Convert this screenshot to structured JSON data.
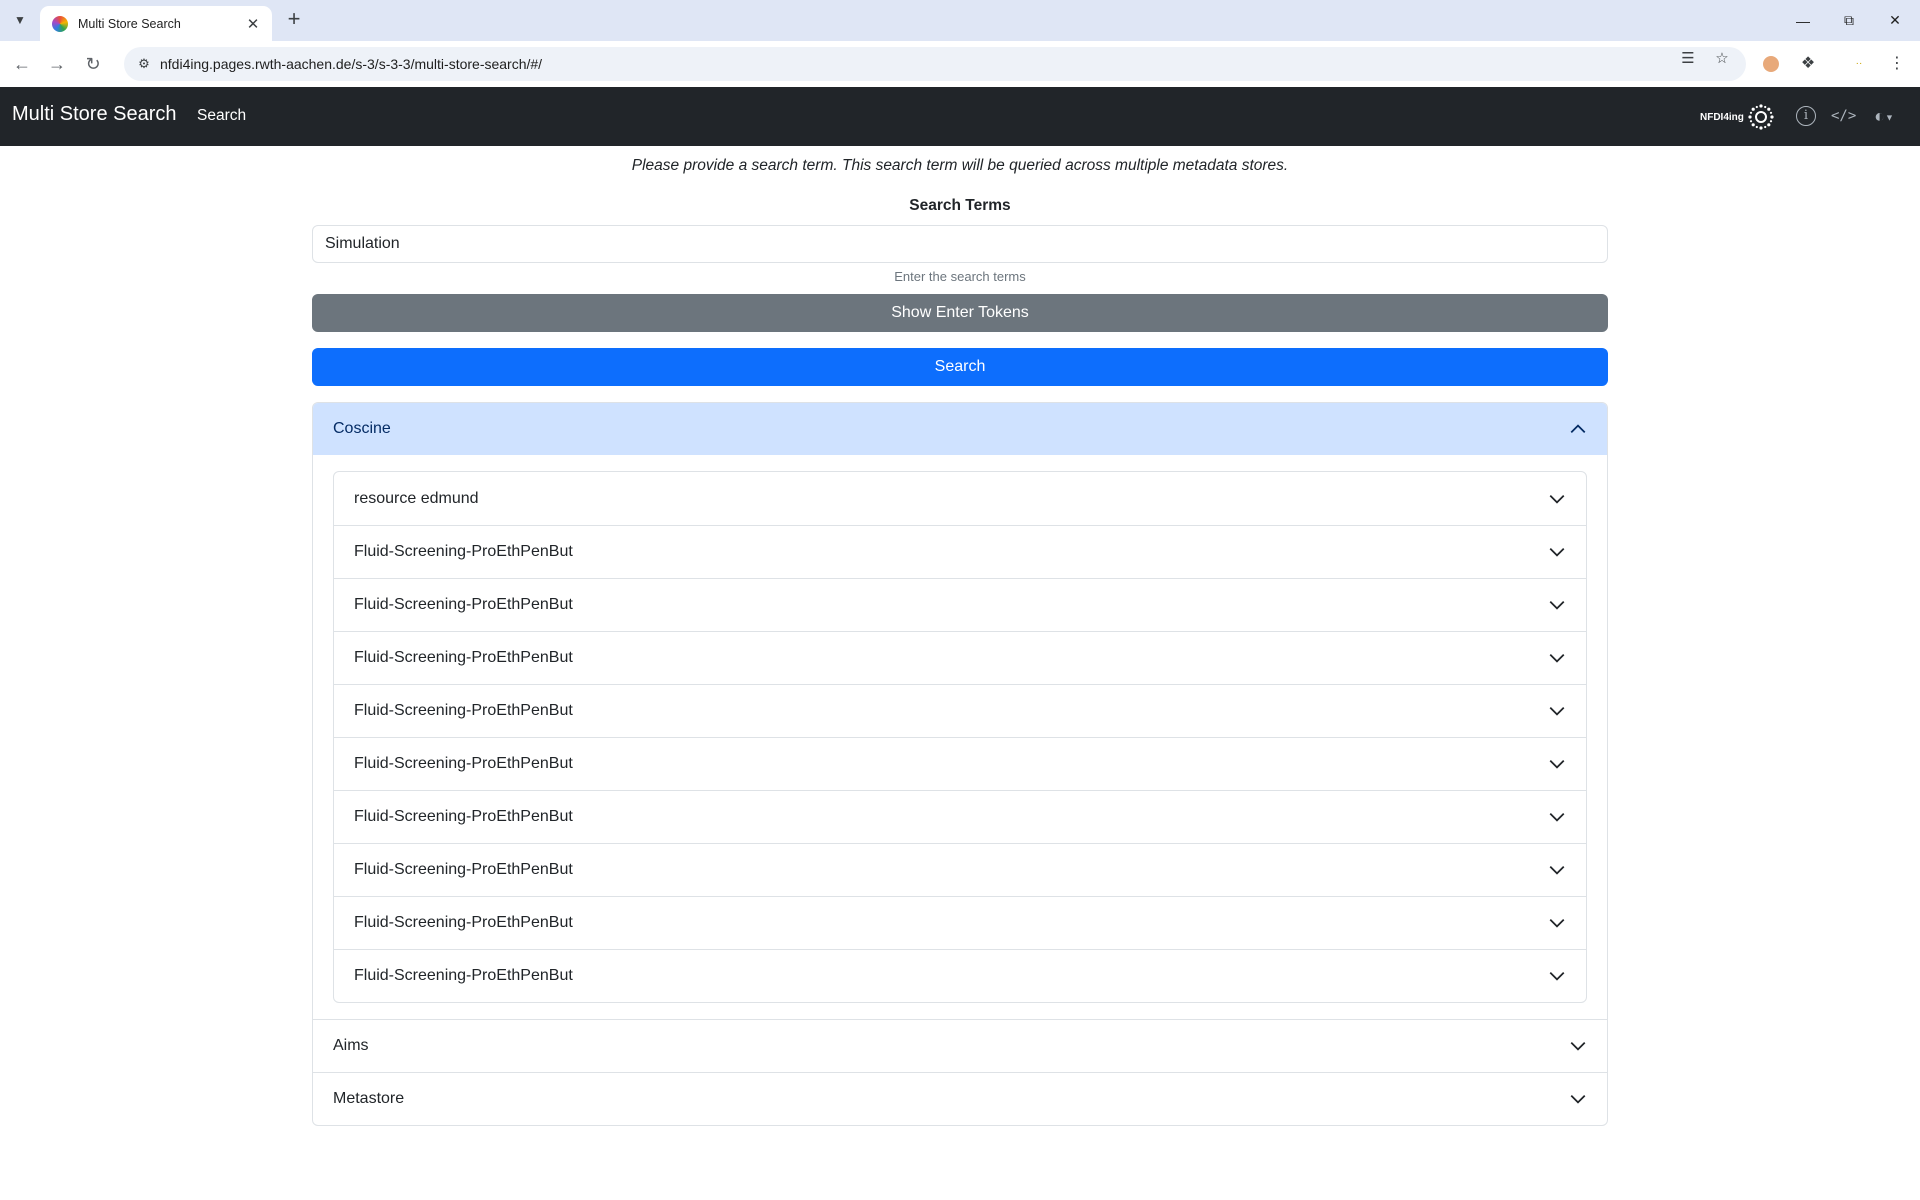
{
  "browser": {
    "tab_title": "Multi Store Search",
    "url": "nfdi4ing.pages.rwth-aachen.de/s-3/s-3-3/multi-store-search/#/"
  },
  "navbar": {
    "brand": "Multi Store Search",
    "link_search": "Search",
    "logo_text": "NFDI4ing"
  },
  "main": {
    "intro": "Please provide a search term. This search term will be queried across multiple metadata stores.",
    "search_label": "Search Terms",
    "search_value": "Simulation",
    "search_help": "Enter the search terms",
    "tokens_button": "Show Enter Tokens",
    "search_button": "Search"
  },
  "stores": [
    {
      "name": "Coscine",
      "expanded": true,
      "results": [
        "resource edmund",
        "Fluid-Screening-ProEthPenBut",
        "Fluid-Screening-ProEthPenBut",
        "Fluid-Screening-ProEthPenBut",
        "Fluid-Screening-ProEthPenBut",
        "Fluid-Screening-ProEthPenBut",
        "Fluid-Screening-ProEthPenBut",
        "Fluid-Screening-ProEthPenBut",
        "Fluid-Screening-ProEthPenBut",
        "Fluid-Screening-ProEthPenBut"
      ]
    },
    {
      "name": "Aims",
      "expanded": false
    },
    {
      "name": "Metastore",
      "expanded": false
    }
  ],
  "colors": {
    "navbar": "#212529",
    "primary": "#0d6efd",
    "secondary": "#6c757d",
    "accordion_active": "#cfe2ff"
  }
}
